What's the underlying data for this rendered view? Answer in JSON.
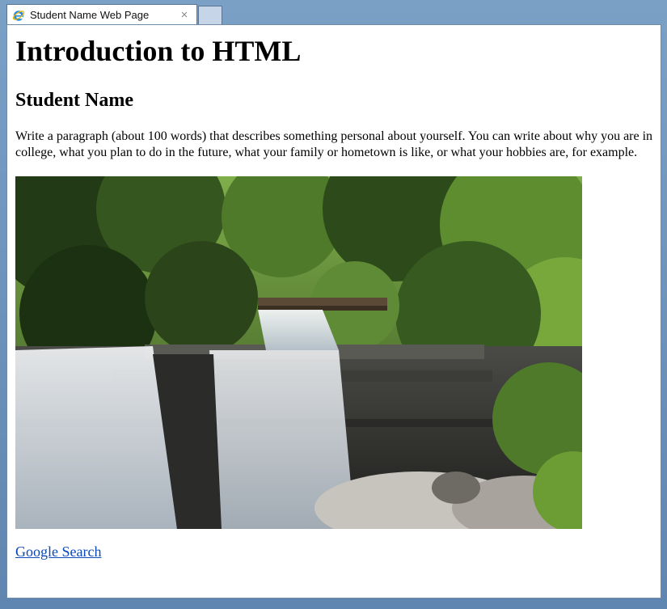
{
  "browser": {
    "tab_title": "Student Name Web Page",
    "tab_close": "×",
    "tab_icon": "internet-explorer-icon"
  },
  "page": {
    "heading": "Introduction to HTML",
    "subheading": "Student Name",
    "paragraph": "Write a paragraph (about 100 words) that describes something personal about yourself. You can write about why you are in college, what you plan to do in the future, what your family or hometown is like, or what your hobbies are, for example.",
    "image_subject": "waterfall-in-forest",
    "link_text": "Google Search"
  }
}
